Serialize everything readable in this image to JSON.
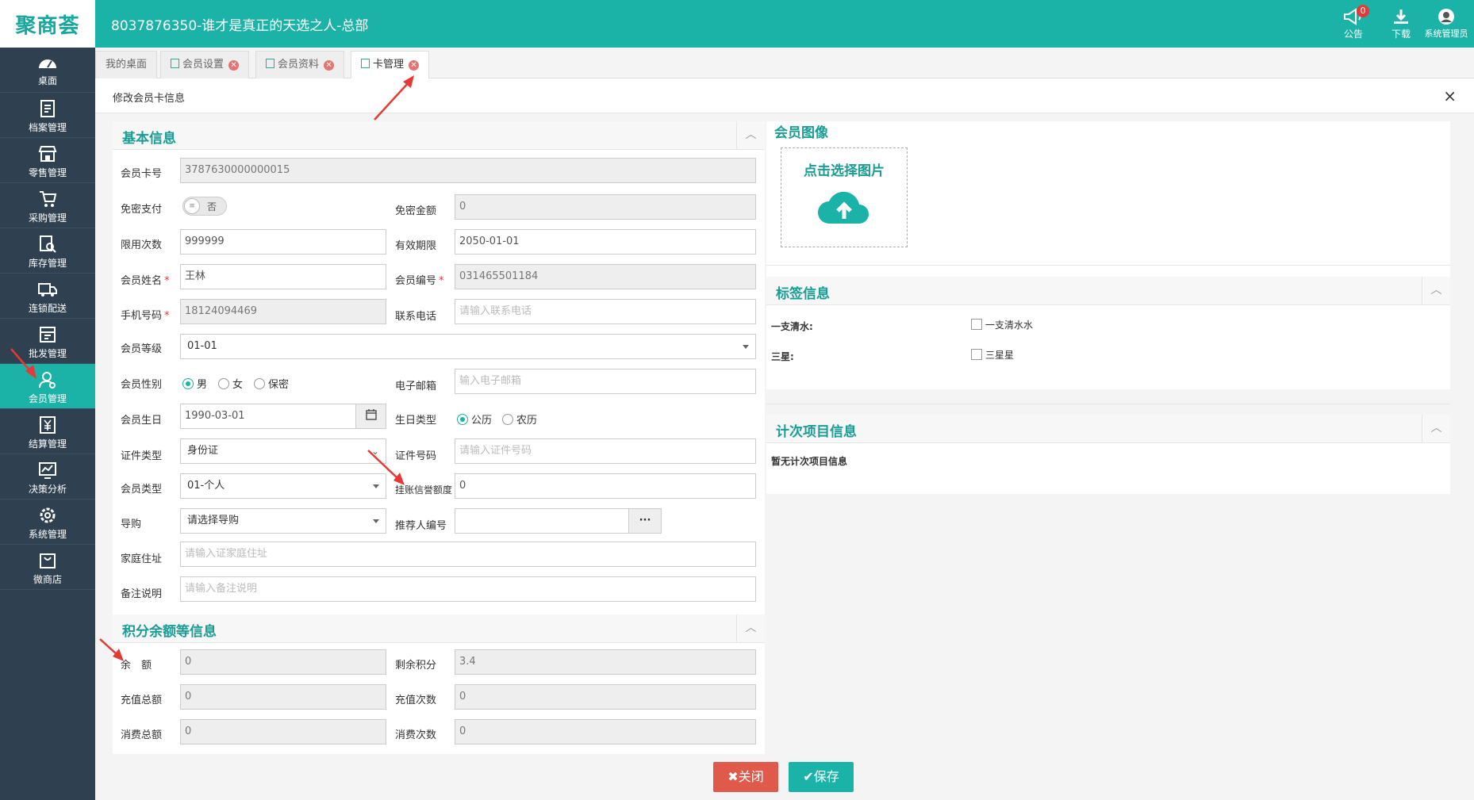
{
  "header": {
    "logo": "聚商荟",
    "title": "8037876350-谁才是真正的天选之人-总部",
    "notice_label": "公告",
    "notice_count": "0",
    "download_label": "下载",
    "user_label": "系统管理员"
  },
  "sidebar": {
    "items": [
      {
        "label": "桌面",
        "icon": "dashboard-icon"
      },
      {
        "label": "档案管理",
        "icon": "file-icon"
      },
      {
        "label": "零售管理",
        "icon": "store-icon"
      },
      {
        "label": "采购管理",
        "icon": "cart-icon"
      },
      {
        "label": "库存管理",
        "icon": "inventory-icon"
      },
      {
        "label": "连锁配送",
        "icon": "truck-icon"
      },
      {
        "label": "批发管理",
        "icon": "wholesale-icon"
      },
      {
        "label": "会员管理",
        "icon": "member-icon"
      },
      {
        "label": "结算管理",
        "icon": "yen-icon"
      },
      {
        "label": "决策分析",
        "icon": "chart-icon"
      },
      {
        "label": "系统管理",
        "icon": "gear-icon"
      },
      {
        "label": "微商店",
        "icon": "bag-icon"
      }
    ],
    "active_index": 7
  },
  "tabs": [
    {
      "label": "我的桌面"
    },
    {
      "label": "会员设置"
    },
    {
      "label": "会员资料"
    },
    {
      "label": "卡管理"
    }
  ],
  "page": {
    "title": "修改会员卡信息",
    "close_glyph": "×"
  },
  "basic": {
    "section_title": "基本信息",
    "card_no_label": "会员卡号",
    "card_no": "3787630000000015",
    "free_pay_label": "免密支付",
    "free_pay_state": "否",
    "free_amount_label": "免密金额",
    "free_amount": "0",
    "limit_times_label": "限用次数",
    "limit_times": "999999",
    "expiry_label": "有效期限",
    "expiry": "2050-01-01",
    "name_label": "会员姓名",
    "name": "王林",
    "member_no_label": "会员编号",
    "member_no": "031465501184",
    "mobile_label": "手机号码",
    "mobile": "18124094469",
    "phone_label": "联系电话",
    "phone_placeholder": "请输入联系电话",
    "level_label": "会员等级",
    "level": "01-01",
    "gender_label": "会员性别",
    "gender_options": [
      "男",
      "女",
      "保密"
    ],
    "email_label": "电子邮箱",
    "email_placeholder": "输入电子邮箱",
    "birthday_label": "会员生日",
    "birthday": "1990-03-01",
    "birth_type_label": "生日类型",
    "birth_type_options": [
      "公历",
      "农历"
    ],
    "id_type_label": "证件类型",
    "id_type": "身份证",
    "id_no_label": "证件号码",
    "id_no_placeholder": "请输入证件号码",
    "member_type_label": "会员类型",
    "member_type": "01-个人",
    "credit_label": "挂账信誉额度",
    "credit": "0",
    "guide_label": "导购",
    "guide": "请选择导购",
    "referrer_label": "推荐人编号",
    "referrer_btn": "···",
    "address_label": "家庭住址",
    "address_placeholder": "请输入证家庭住址",
    "remark_label": "备注说明",
    "remark_placeholder": "请输入备注说明"
  },
  "points": {
    "section_title": "积分余额等信息",
    "balance_label": "余　额",
    "balance": "0",
    "remaining_points_label": "剩余积分",
    "remaining_points": "3.4",
    "recharge_total_label": "充值总额",
    "recharge_total": "0",
    "recharge_count_label": "充值次数",
    "recharge_count": "0",
    "consume_total_label": "消费总额",
    "consume_total": "0",
    "consume_count_label": "消费次数",
    "consume_count": "0"
  },
  "image": {
    "section_title": "会员图像",
    "upload_text": "点击选择图片"
  },
  "tags": {
    "section_title": "标签信息",
    "rows": [
      {
        "label": "一支清水:",
        "option": "一支清水水"
      },
      {
        "label": "三星:",
        "option": "三星星"
      }
    ]
  },
  "count_items": {
    "section_title": "计次项目信息",
    "empty_text": "暂无计次项目信息"
  },
  "actions": {
    "close_label": "✖关闭",
    "save_label": "✔保存"
  },
  "colors": {
    "primary": "#1bb3a8",
    "sidebar": "#2f4050",
    "danger": "#e05a4c"
  }
}
